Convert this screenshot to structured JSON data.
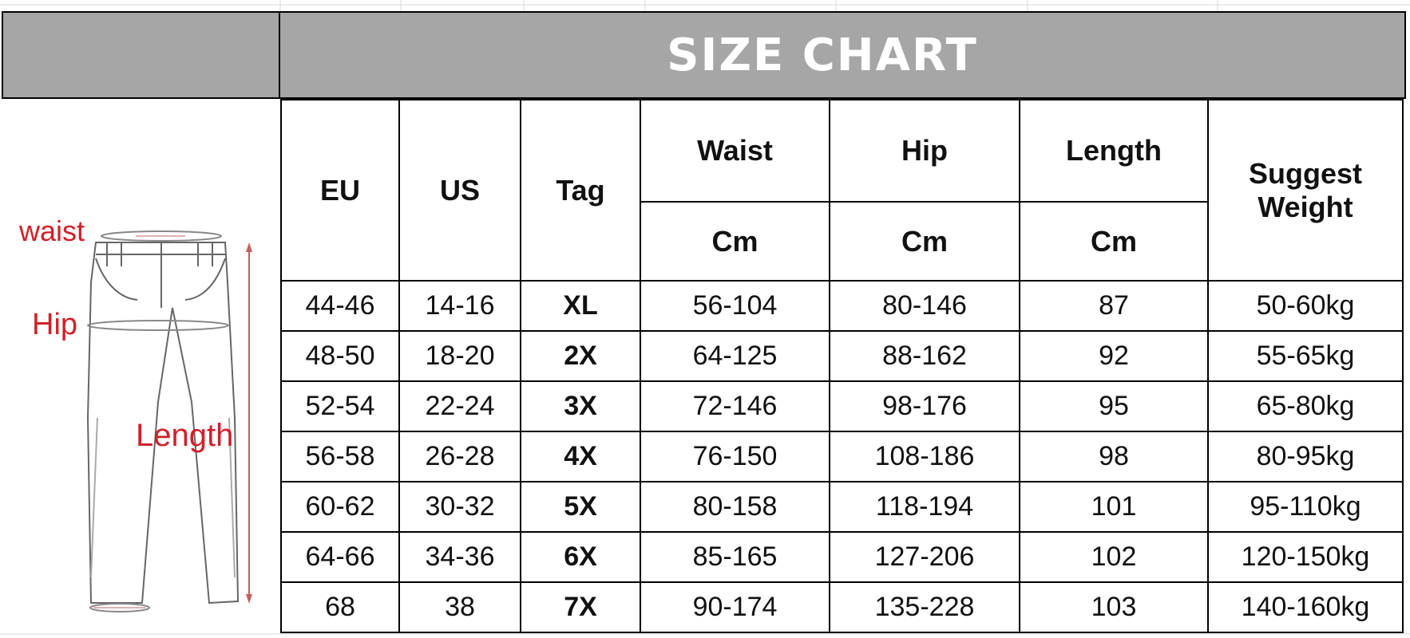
{
  "title": "SIZE CHART",
  "diagram": {
    "waist_label": "waist",
    "hip_label": "Hip",
    "length_label": "Length"
  },
  "headers": {
    "eu": "EU",
    "us": "US",
    "tag": "Tag",
    "waist": "Waist",
    "hip": "Hip",
    "length": "Length",
    "suggest_weight_line1": "Suggest",
    "suggest_weight_line2": "Weight",
    "unit_waist": "Cm",
    "unit_hip": "Cm",
    "unit_length": "Cm"
  },
  "rows": [
    {
      "eu": "44-46",
      "us": "14-16",
      "tag": "XL",
      "waist": "56-104",
      "hip": "80-146",
      "length": "87",
      "weight": "50-60kg"
    },
    {
      "eu": "48-50",
      "us": "18-20",
      "tag": "2X",
      "waist": "64-125",
      "hip": "88-162",
      "length": "92",
      "weight": "55-65kg"
    },
    {
      "eu": "52-54",
      "us": "22-24",
      "tag": "3X",
      "waist": "72-146",
      "hip": "98-176",
      "length": "95",
      "weight": "65-80kg"
    },
    {
      "eu": "56-58",
      "us": "26-28",
      "tag": "4X",
      "waist": "76-150",
      "hip": "108-186",
      "length": "98",
      "weight": "80-95kg"
    },
    {
      "eu": "60-62",
      "us": "30-32",
      "tag": "5X",
      "waist": "80-158",
      "hip": "118-194",
      "length": "101",
      "weight": "95-110kg"
    },
    {
      "eu": "64-66",
      "us": "34-36",
      "tag": "6X",
      "waist": "85-165",
      "hip": "127-206",
      "length": "102",
      "weight": "120-150kg"
    },
    {
      "eu": "68",
      "us": "38",
      "tag": "7X",
      "waist": "90-174",
      "hip": "135-228",
      "length": "103",
      "weight": "140-160kg"
    }
  ],
  "colors": {
    "header_bg": "#a6a6a6",
    "title_text": "#ffffff",
    "tag_text": "#3f6fb5",
    "diagram_label": "#d0202a"
  }
}
